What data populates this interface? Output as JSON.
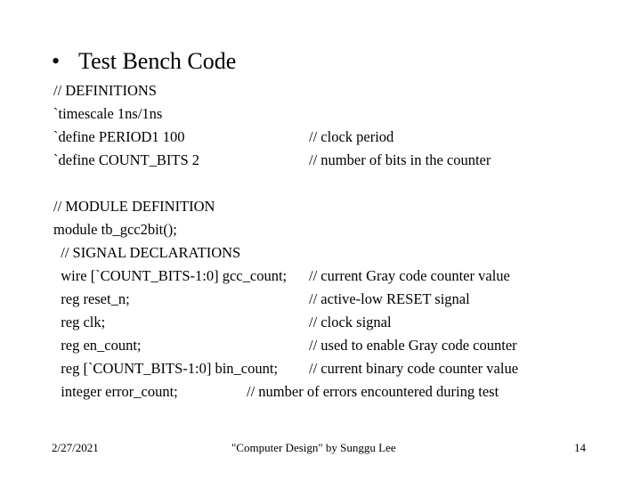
{
  "slide": {
    "title": "Test Bench Code",
    "bullet": "•",
    "code_lines": [
      {
        "code": "// DEFINITIONS",
        "comment": ""
      },
      {
        "code": "`timescale 1ns/1ns",
        "comment": ""
      },
      {
        "code": "`define PERIOD1 100",
        "comment": "// clock period"
      },
      {
        "code": "`define COUNT_BITS 2",
        "comment": "// number of bits in the counter"
      },
      {
        "code": "",
        "comment": ""
      },
      {
        "code": "// MODULE DEFINITION",
        "comment": ""
      },
      {
        "code": "module tb_gcc2bit();",
        "comment": ""
      },
      {
        "code": "  // SIGNAL DECLARATIONS",
        "comment": ""
      },
      {
        "code": "  wire [`COUNT_BITS-1:0] gcc_count;",
        "comment": "// current Gray code counter value"
      },
      {
        "code": "  reg reset_n;",
        "comment": "// active-low RESET signal"
      },
      {
        "code": "  reg clk;",
        "comment": "// clock signal"
      },
      {
        "code": "  reg en_count;",
        "comment": "// used to enable Gray code counter"
      },
      {
        "code": "  reg [`COUNT_BITS-1:0] bin_count;",
        "comment": "// current binary code counter value"
      },
      {
        "code": "  integer error_count;",
        "comment": "// number of errors encountered during test"
      }
    ]
  },
  "footer": {
    "date": "2/27/2021",
    "center": "\"Computer Design\" by Sunggu Lee",
    "page_number": "14"
  }
}
